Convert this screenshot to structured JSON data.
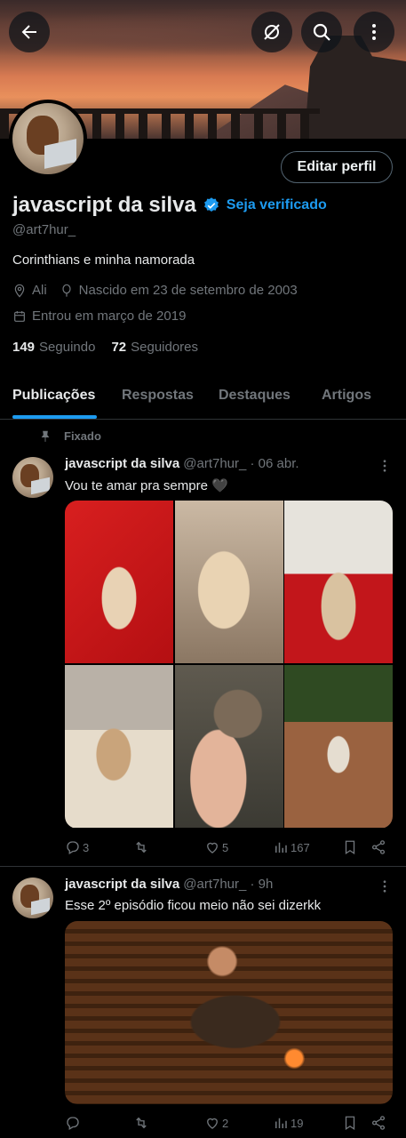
{
  "header": {
    "back_icon": "arrow-left-icon",
    "action_icons": [
      "grok-icon",
      "search-icon",
      "more-vertical-icon"
    ]
  },
  "profile": {
    "edit_label": "Editar perfil",
    "name": "javascript da silva",
    "get_verified": "Seja verificado",
    "handle": "@art7hur_",
    "bio": "Corinthians e minha namorada",
    "location": "Ali",
    "birth": "Nascido em 23 de setembro de 2003",
    "joined": "Entrou em março de 2019",
    "following_count": "149",
    "following_label": "Seguindo",
    "followers_count": "72",
    "followers_label": "Seguidores"
  },
  "tabs": [
    "Publicações",
    "Respostas",
    "Destaques",
    "Artigos"
  ],
  "posts": [
    {
      "pinned_label": "Fixado",
      "name": "javascript da silva",
      "handle_time": "@art7hur_ · 06 abr.",
      "text": "Vou te amar pra sempre 🖤",
      "replies": "3",
      "reposts": "",
      "likes": "5",
      "views": "167"
    },
    {
      "name": "javascript da silva",
      "handle_time": "@art7hur_ · 9h",
      "text": "Esse 2º episódio ficou meio não sei dizerkk",
      "replies": "",
      "reposts": "",
      "likes": "2",
      "views": "19"
    }
  ],
  "colors": {
    "accent": "#1d9bf0",
    "muted": "#71767b",
    "background": "#000000",
    "text": "#e7e9ea"
  }
}
